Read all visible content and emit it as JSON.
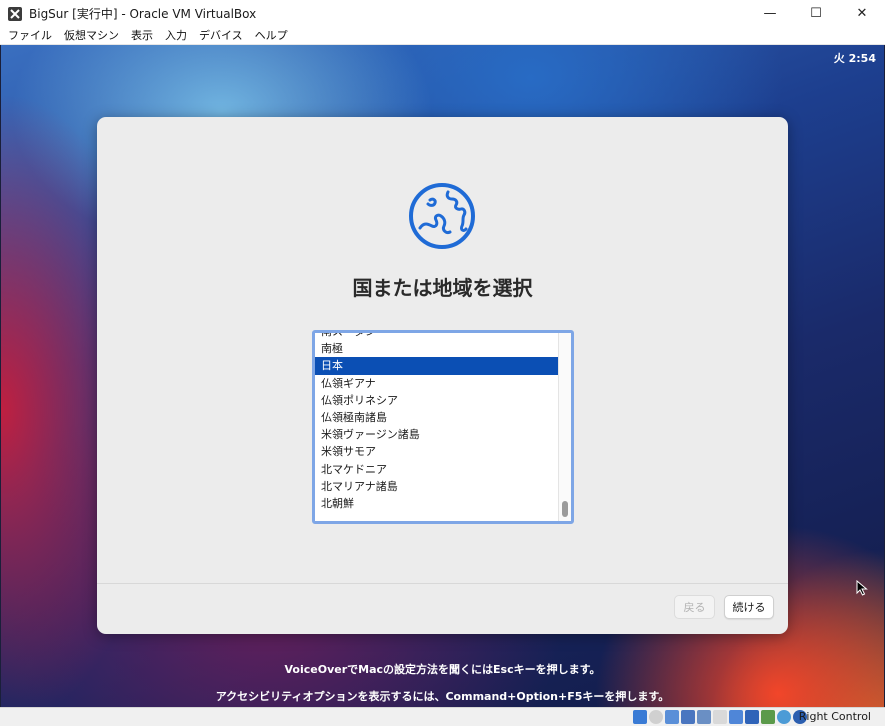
{
  "window": {
    "title": "BigSur [実行中] - Oracle VM VirtualBox",
    "minimize_glyph": "—",
    "maximize_glyph": "☐",
    "close_glyph": "✕",
    "app_icon": "virtualbox-icon"
  },
  "menubar": {
    "items": [
      {
        "label": "ファイル"
      },
      {
        "label": "仮想マシン"
      },
      {
        "label": "表示"
      },
      {
        "label": "入力"
      },
      {
        "label": "デバイス"
      },
      {
        "label": "ヘルプ"
      }
    ]
  },
  "mac": {
    "clock": "火 2:54"
  },
  "setup": {
    "icon": "globe-icon",
    "title": "国または地域を選択",
    "list": [
      {
        "label": "南スーダン",
        "selected": false
      },
      {
        "label": "南極",
        "selected": false
      },
      {
        "label": "日本",
        "selected": true
      },
      {
        "label": "仏領ギアナ",
        "selected": false
      },
      {
        "label": "仏領ポリネシア",
        "selected": false
      },
      {
        "label": "仏領極南諸島",
        "selected": false
      },
      {
        "label": "米領ヴァージン諸島",
        "selected": false
      },
      {
        "label": "米領サモア",
        "selected": false
      },
      {
        "label": "北マケドニア",
        "selected": false
      },
      {
        "label": "北マリアナ諸島",
        "selected": false
      },
      {
        "label": "北朝鮮",
        "selected": false
      }
    ],
    "back_label": "戻る",
    "continue_label": "続ける"
  },
  "instructions": {
    "voiceover": "VoiceOverでMacの設定方法を聞くにはEscキーを押します。",
    "accessibility": "アクセシビリティオプションを表示するには、Command+Option+F5キーを押します。"
  },
  "statusbar": {
    "host_key": "Right Control",
    "icons": [
      "hard-disk-icon",
      "optical-drive-icon",
      "audio-icon",
      "network-icon",
      "usb-icon",
      "shared-folder-icon",
      "display-icon",
      "video-capture-icon",
      "vt-x-icon",
      "mouse-integration-icon",
      "arrow-down-icon"
    ],
    "colors": {
      "accent": "#2a6fd6",
      "selection": "#0b4fb4"
    }
  }
}
